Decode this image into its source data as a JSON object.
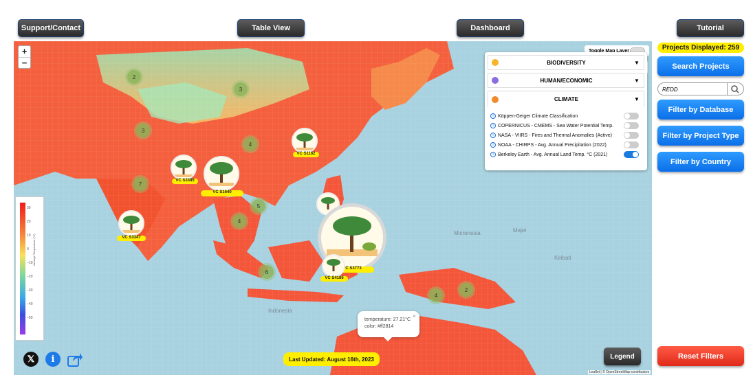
{
  "nav": {
    "support": "Support/Contact",
    "table_view": "Table View",
    "dashboard": "Dashboard",
    "tutorial": "Tutorial"
  },
  "sidebar": {
    "projects_displayed": "Projects Displayed: 259",
    "search_projects": "Search Projects",
    "search_value": "REDD",
    "filter_database": "Filter by Database",
    "filter_project_type": "Filter by Project Type",
    "filter_country": "Filter by Country",
    "reset_filters": "Reset Filters"
  },
  "map": {
    "zoom_in": "+",
    "zoom_out": "−",
    "toggle_layer_label": "Toggle Map Layer",
    "last_updated": "Last Updated: August 16th, 2023",
    "legend_button": "Legend",
    "attribution": "Leaflet | © OpenStreetMap contributors",
    "popup_line1": "temperature: 27.21°C",
    "popup_line2": "color: #ff2814",
    "popup_close": "×",
    "legend_scale": {
      "title": "Average Temperature (°C)",
      "ticks": [
        "30",
        "20",
        "10",
        "0",
        "−10",
        "−20",
        "−30",
        "−40",
        "−50"
      ]
    },
    "place_labels": [
      "Micronesia",
      "Majel",
      "Kiribati",
      "Indonesia"
    ],
    "clusters": [
      "2",
      "3",
      "3",
      "4",
      "7",
      "5",
      "4",
      "6",
      "4",
      "2"
    ],
    "markers": [
      "VC S1162",
      "VC S3385",
      "VC S1640",
      "VC S3347",
      "VC S3773",
      "VC S4186"
    ]
  },
  "layers_panel": {
    "biodiversity": "BIODIVERSITY",
    "human_economic": "HUMAN/ECONOMIC",
    "climate": "CLIMATE",
    "climate_layers": [
      {
        "label": "Köppen-Geiger Climate Classification",
        "on": false
      },
      {
        "label": "COPERNICUS - CMEMS - Sea Water Potential Temp.",
        "on": false
      },
      {
        "label": "NASA - VIIRS - Fires and Thermal Anomalies (Active)",
        "on": false
      },
      {
        "label": "NOAA - CHIRPS - Avg. Annual Precipitation (2022)",
        "on": false
      },
      {
        "label": "Berkeley Earth - Avg. Annual Land Temp. °C (2021)",
        "on": true
      }
    ]
  },
  "colors": {
    "accent_blue": "#0b6fe8",
    "highlight_yellow": "#ffee00",
    "reset_red": "#f03a2a",
    "ocean": "#a9d2e0",
    "hot_land": "#f4563a"
  }
}
